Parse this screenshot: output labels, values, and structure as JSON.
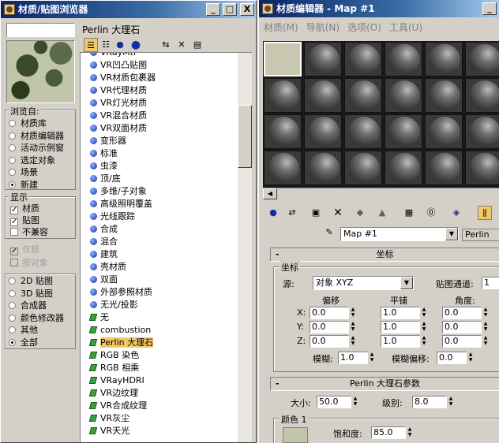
{
  "left_window": {
    "title": "材质/贴图浏览器",
    "buttons": {
      "minimize": "_",
      "maximize": "□",
      "close": "X"
    },
    "search_value": "",
    "current_name": "Perlin 大理石",
    "browse_from": {
      "label": "浏览自:",
      "options": [
        "材质库",
        "材质编辑器",
        "活动示例窗",
        "选定对象",
        "场景",
        "新建"
      ],
      "selected_index": 5
    },
    "show": {
      "label": "显示",
      "options": [
        {
          "label": "材质",
          "checked": true
        },
        {
          "label": "贴图",
          "checked": true
        },
        {
          "label": "不兼容",
          "checked": false
        }
      ]
    },
    "extra": [
      {
        "label": "仅根",
        "checked": true
      },
      {
        "label": "按对象",
        "checked": false
      }
    ],
    "map_filter": {
      "options": [
        "2D 贴图",
        "3D 贴图",
        "合成器",
        "颜色修改器",
        "其他",
        "全部"
      ],
      "selected_index": 5
    },
    "list_items": [
      {
        "label": "VRayMtl",
        "kind": "material"
      },
      {
        "label": "VR凹凸贴图",
        "kind": "material"
      },
      {
        "label": "VR材质包裹器",
        "kind": "material"
      },
      {
        "label": "VR代理材质",
        "kind": "material"
      },
      {
        "label": "VR灯光材质",
        "kind": "material"
      },
      {
        "label": "VR混合材质",
        "kind": "material"
      },
      {
        "label": "VR双面材质",
        "kind": "material"
      },
      {
        "label": "变形器",
        "kind": "material"
      },
      {
        "label": "标准",
        "kind": "material"
      },
      {
        "label": "虫漆",
        "kind": "material"
      },
      {
        "label": "顶/底",
        "kind": "material"
      },
      {
        "label": "多维/子对象",
        "kind": "material"
      },
      {
        "label": "高级照明覆盖",
        "kind": "material"
      },
      {
        "label": "光线跟踪",
        "kind": "material"
      },
      {
        "label": "合成",
        "kind": "material"
      },
      {
        "label": "混合",
        "kind": "material"
      },
      {
        "label": "建筑",
        "kind": "material"
      },
      {
        "label": "壳材质",
        "kind": "material"
      },
      {
        "label": "双面",
        "kind": "material"
      },
      {
        "label": "外部参照材质",
        "kind": "material"
      },
      {
        "label": "无光/投影",
        "kind": "material"
      },
      {
        "label": "无",
        "kind": "map"
      },
      {
        "label": "combustion",
        "kind": "map"
      },
      {
        "label": "Perlin 大理石",
        "kind": "map",
        "selected": true
      },
      {
        "label": "RGB 染色",
        "kind": "map"
      },
      {
        "label": "RGB 相乘",
        "kind": "map"
      },
      {
        "label": "VRayHDRI",
        "kind": "map"
      },
      {
        "label": "VR边纹理",
        "kind": "map"
      },
      {
        "label": "VR合成纹理",
        "kind": "map"
      },
      {
        "label": "VR灰尘",
        "kind": "map"
      },
      {
        "label": "VR天光",
        "kind": "map"
      }
    ]
  },
  "right_window": {
    "title": "材质编辑器 - Map #1",
    "buttons": {
      "minimize": "_"
    },
    "menu": [
      "材质(M)",
      "导航(N)",
      "选项(O)",
      "工具(U)"
    ],
    "map_name": "Map #1",
    "map_type": "Perlin",
    "coords": {
      "header": "坐标",
      "group_label": "坐标",
      "source_label": "源:",
      "source_value": "对象 XYZ",
      "map_channel_label": "贴图通道:",
      "map_channel_value": "1",
      "col_offset": "偏移",
      "col_tiling": "平铺",
      "col_angle": "角度:",
      "rows": [
        {
          "axis": "X:",
          "offset": "0.0",
          "tiling": "1.0",
          "angle": "0.0"
        },
        {
          "axis": "Y:",
          "offset": "0.0",
          "tiling": "1.0",
          "angle": "0.0"
        },
        {
          "axis": "Z:",
          "offset": "0.0",
          "tiling": "1.0",
          "angle": "0.0"
        }
      ],
      "blur_label": "模糊:",
      "blur_value": "1.0",
      "blur_offset_label": "模糊偏移:",
      "blur_offset_value": "0.0"
    },
    "perlin": {
      "header": "Perlin 大理石参数",
      "size_label": "大小:",
      "size_value": "50.0",
      "levels_label": "级别:",
      "levels_value": "8.0",
      "color1_label": "颜色 1",
      "saturation_label": "饱和度:",
      "saturation_value": "85.0"
    }
  },
  "colors": {
    "title_start": "#0a246a",
    "title_end": "#a6caf0",
    "selection": "#f2c868",
    "face": "#d4d0c8"
  }
}
